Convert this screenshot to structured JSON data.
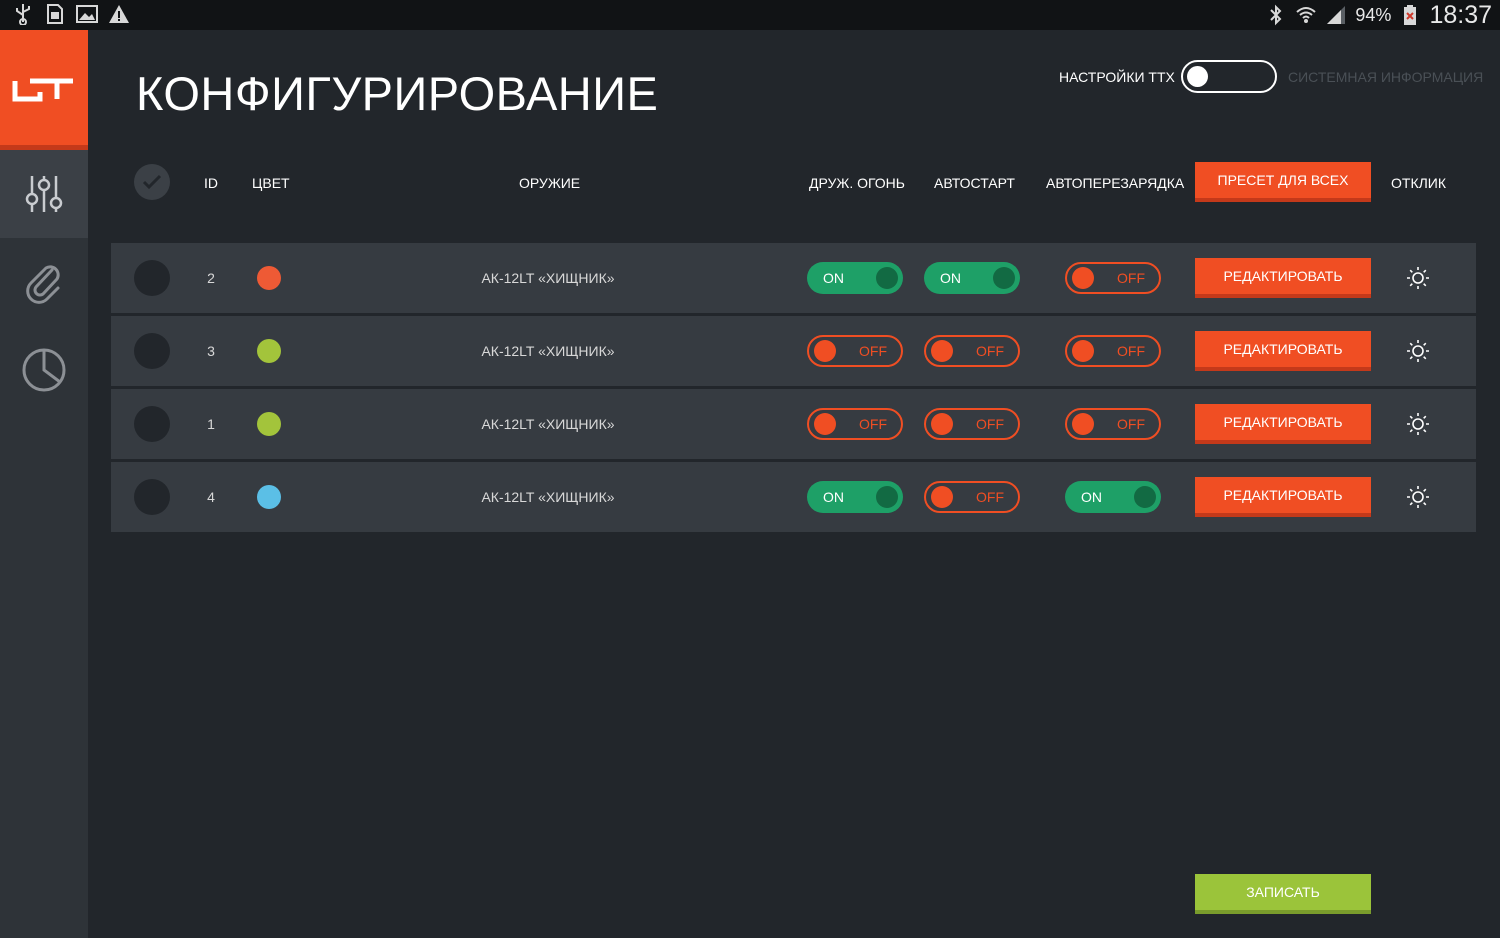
{
  "status_bar": {
    "icons": [
      "usb-icon",
      "sim-icon",
      "image-icon",
      "warning-icon",
      "bluetooth-icon",
      "wifi-icon",
      "signal-icon",
      "battery-icon"
    ],
    "battery": "94%",
    "time": "18:37"
  },
  "sidebar": {
    "logo": "LT",
    "items": [
      {
        "icon": "sliders-icon",
        "active": true
      },
      {
        "icon": "paperclip-icon",
        "active": false
      },
      {
        "icon": "pie-chart-icon",
        "active": false
      }
    ]
  },
  "header": {
    "title": "КОНФИГУРИРОВАНИЕ",
    "ttx_label": "НАСТРОЙКИ ТТХ",
    "sysinfo_label": "СИСТЕМНАЯ ИНФОРМАЦИЯ"
  },
  "table": {
    "columns": {
      "id": "ID",
      "color": "ЦВЕТ",
      "weapon": "ОРУЖИЕ",
      "friendly_fire": "ДРУЖ. ОГОНЬ",
      "autostart": "АВТОСТАРТ",
      "autoreload": "АВТОПЕРЕЗАРЯДКА",
      "preset": "ПРЕСЕТ ДЛЯ ВСЕХ",
      "response": "ОТКЛИК"
    },
    "rows": [
      {
        "id": "2",
        "color": "#ee5a35",
        "weapon": "АК-12LT «ХИЩНИК»",
        "friendly_fire": "ON",
        "autostart": "ON",
        "autoreload": "OFF",
        "edit": "РЕДАКТИРОВАТЬ"
      },
      {
        "id": "3",
        "color": "#a3c43b",
        "weapon": "АК-12LT «ХИЩНИК»",
        "friendly_fire": "OFF",
        "autostart": "OFF",
        "autoreload": "OFF",
        "edit": "РЕДАКТИРОВАТЬ"
      },
      {
        "id": "1",
        "color": "#a3c43b",
        "weapon": "АК-12LT «ХИЩНИК»",
        "friendly_fire": "OFF",
        "autostart": "OFF",
        "autoreload": "OFF",
        "edit": "РЕДАКТИРОВАТЬ"
      },
      {
        "id": "4",
        "color": "#5bbfe6",
        "weapon": "АК-12LT «ХИЩНИК»",
        "friendly_fire": "ON",
        "autostart": "OFF",
        "autoreload": "ON",
        "edit": "РЕДАКТИРОВАТЬ"
      }
    ]
  },
  "footer": {
    "save_label": "ЗАПИСАТЬ"
  },
  "colors": {
    "accent": "#f04e23",
    "on": "#1ea067",
    "save": "#9bc43a",
    "background": "#22262b",
    "sidebar": "#2e3338"
  }
}
